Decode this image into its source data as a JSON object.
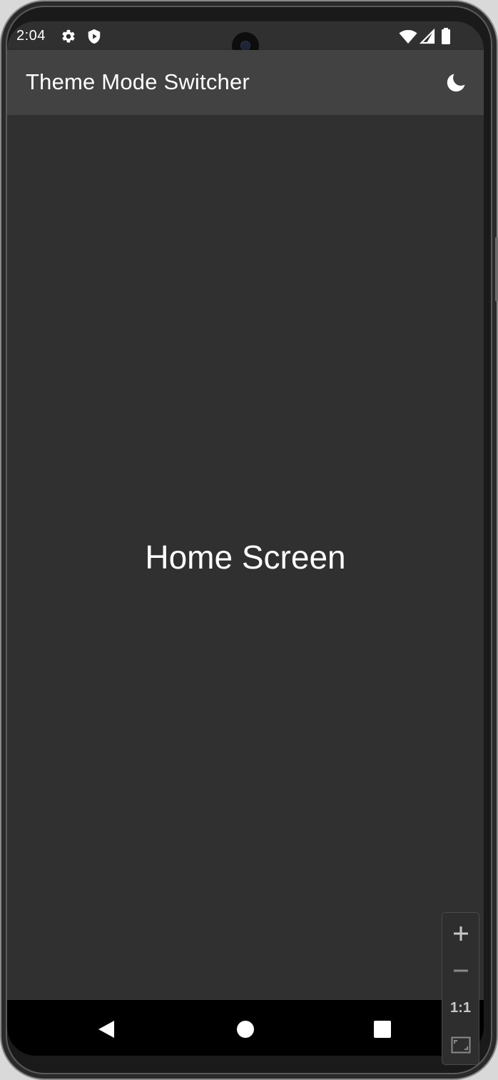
{
  "status_bar": {
    "time": "2:04",
    "icons": [
      "gear-icon",
      "shield-icon",
      "wifi-icon",
      "cellular-icon",
      "battery-icon"
    ]
  },
  "app_bar": {
    "title": "Theme Mode Switcher",
    "action_icon": "moon-icon"
  },
  "main": {
    "label": "Home Screen"
  },
  "nav_bar": {
    "buttons": [
      "back-icon",
      "home-icon",
      "recents-icon"
    ]
  },
  "zoom_controls": {
    "reset_label": "1:1",
    "buttons": [
      "zoom-in-icon",
      "zoom-out-icon",
      "fit-screen-icon"
    ]
  },
  "colors": {
    "background": "#303030",
    "app_bar": "#424242",
    "text": "#ffffff",
    "nav_bar": "#000000"
  }
}
